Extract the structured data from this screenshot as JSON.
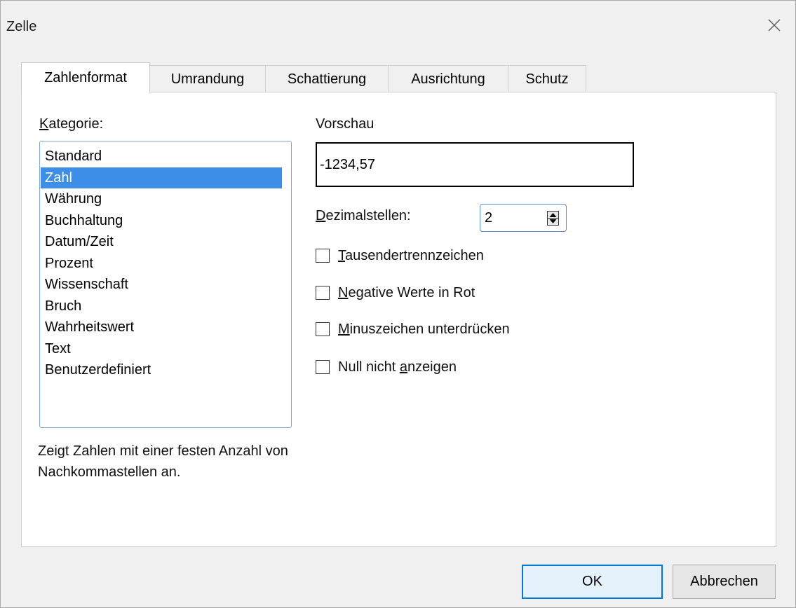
{
  "window": {
    "title": "Zelle"
  },
  "tabs": [
    {
      "label": "Zahlenformat",
      "active": true
    },
    {
      "label": "Umrandung",
      "active": false
    },
    {
      "label": "Schattierung",
      "active": false
    },
    {
      "label": "Ausrichtung",
      "active": false
    },
    {
      "label": "Schutz",
      "active": false
    }
  ],
  "category": {
    "label_mnemonic": "K",
    "label_rest": "ategorie:",
    "items": [
      "Standard",
      "Zahl",
      "Währung",
      "Buchhaltung",
      "Datum/Zeit",
      "Prozent",
      "Wissenschaft",
      "Bruch",
      "Wahrheitswert",
      "Text",
      "Benutzerdefiniert"
    ],
    "selected_index": 1,
    "description": "Zeigt Zahlen mit einer festen Anzahl von Nachkommastellen an."
  },
  "preview": {
    "label": "Vorschau",
    "value": "-1234,57"
  },
  "decimals": {
    "label_mnemonic": "D",
    "label_rest": "ezimalstellen:",
    "value": "2"
  },
  "options": [
    {
      "mnemonic": "T",
      "before": "",
      "after": "ausendertrennzeichen",
      "checked": false
    },
    {
      "mnemonic": "N",
      "before": "",
      "after": "egative Werte in Rot",
      "checked": false
    },
    {
      "mnemonic": "M",
      "before": "",
      "after": "inuszeichen unterdrücken",
      "checked": false
    },
    {
      "mnemonic": "a",
      "before": "Null nicht ",
      "after": "nzeigen",
      "checked": false
    }
  ],
  "buttons": {
    "ok": "OK",
    "cancel": "Abbrechen"
  },
  "colors": {
    "selection": "#3c8ee6",
    "focus_border": "#0078d7"
  }
}
